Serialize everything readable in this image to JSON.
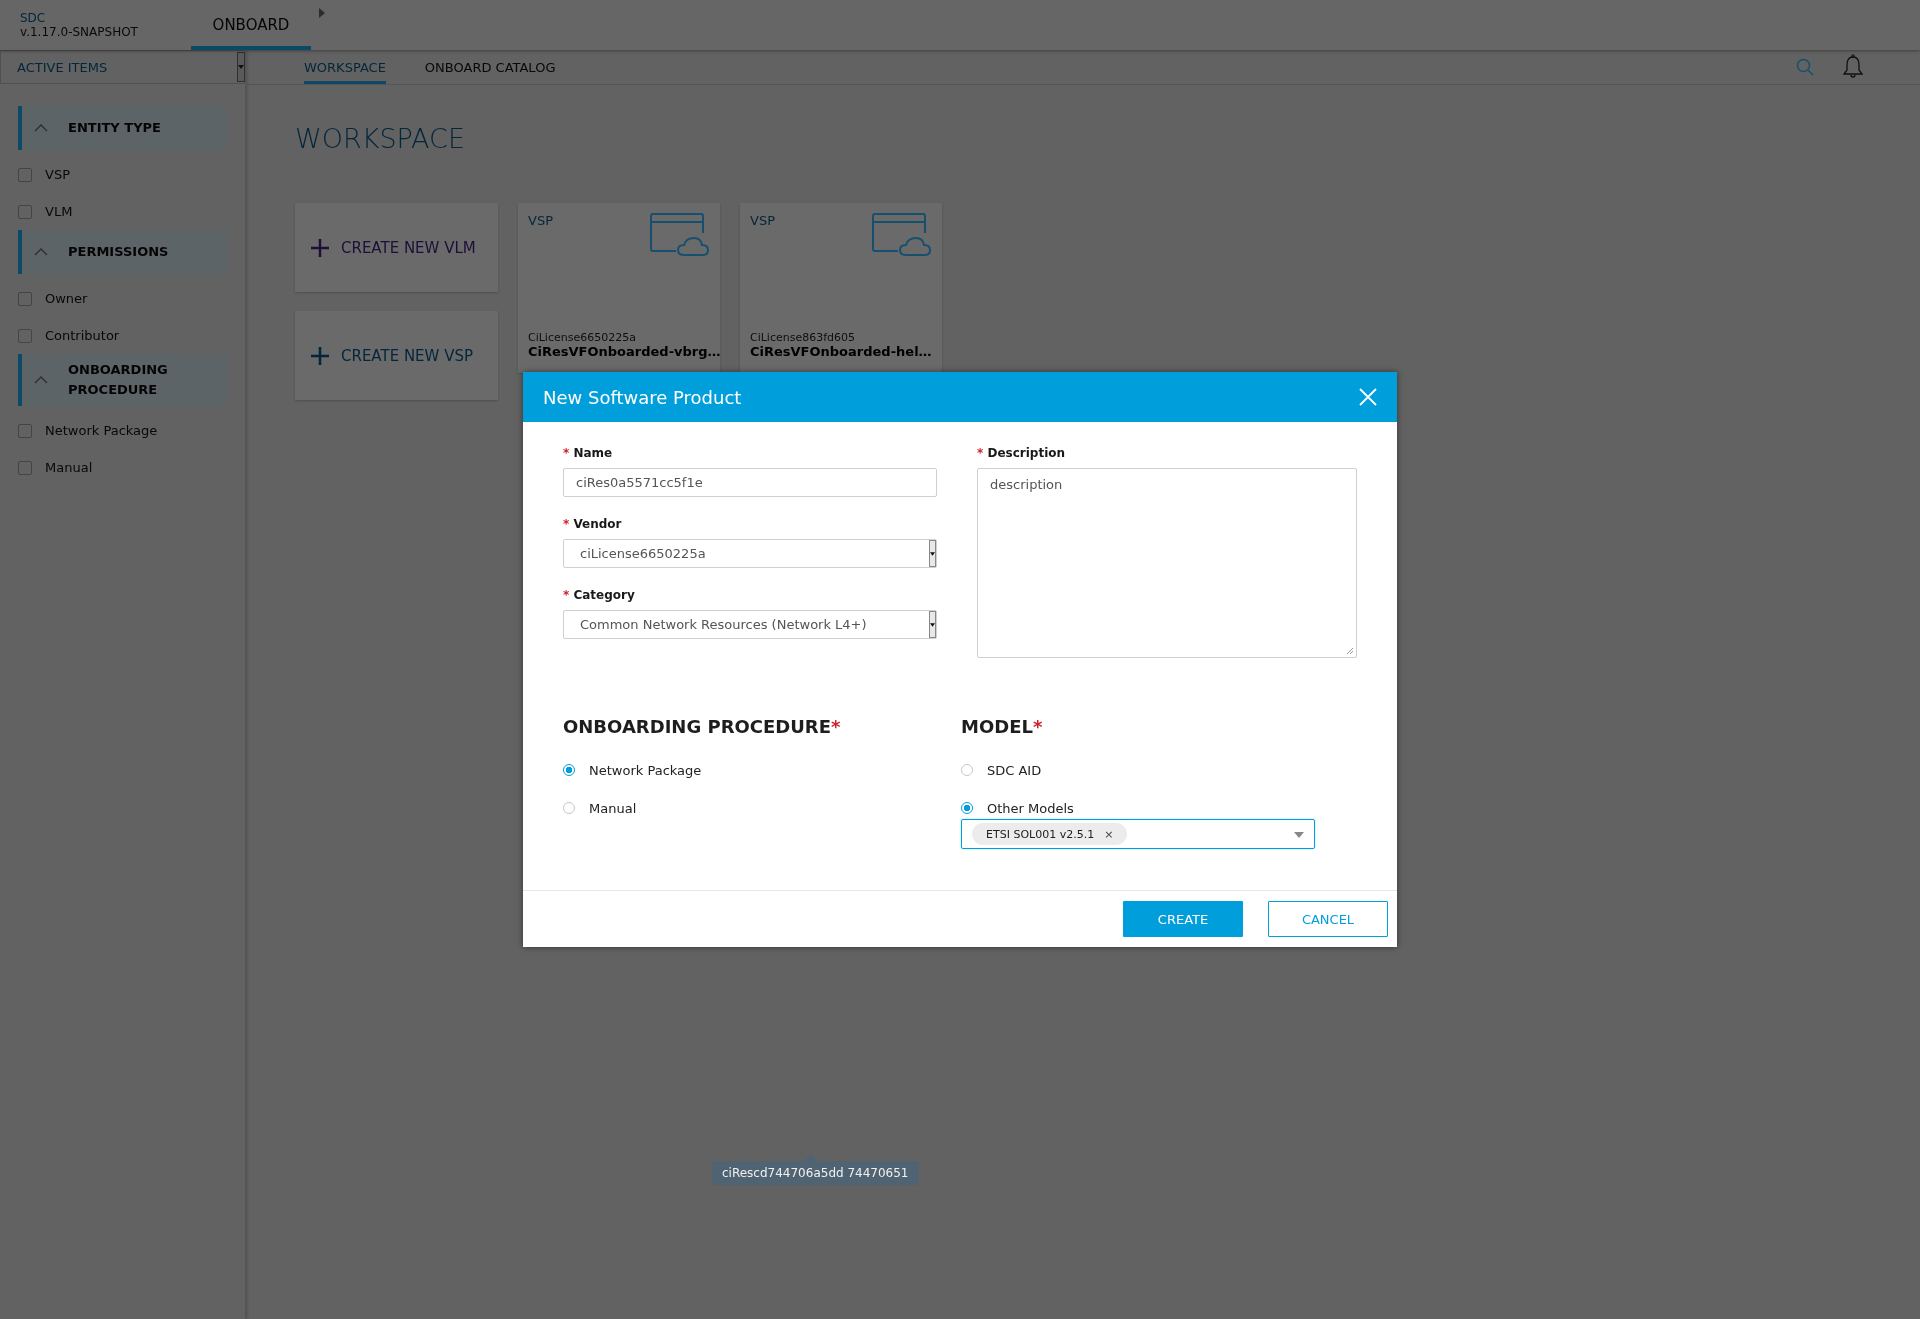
{
  "header": {
    "brand": "SDC",
    "version": "v.1.17.0-SNAPSHOT",
    "tabs": [
      {
        "label": "ONBOARD",
        "selected": true
      }
    ]
  },
  "active_items": {
    "label": "ACTIVE ITEMS"
  },
  "nav_tabs": [
    {
      "label": "WORKSPACE",
      "selected": true
    },
    {
      "label": "ONBOARD CATALOG",
      "selected": false
    }
  ],
  "sidebar": {
    "groups": [
      {
        "title": "ENTITY TYPE",
        "expanded": true,
        "items": [
          {
            "label": "VSP",
            "checked": false
          },
          {
            "label": "VLM",
            "checked": false
          }
        ]
      },
      {
        "title": "PERMISSIONS",
        "expanded": true,
        "items": [
          {
            "label": "Owner",
            "checked": false
          },
          {
            "label": "Contributor",
            "checked": false
          }
        ]
      },
      {
        "title": "ONBOARDING PROCEDURE",
        "expanded": true,
        "items": [
          {
            "label": "Network Package",
            "checked": false
          },
          {
            "label": "Manual",
            "checked": false
          }
        ]
      }
    ]
  },
  "page_title": "WORKSPACE",
  "create_cards": [
    {
      "label": "CREATE NEW VLM",
      "kind": "vlm"
    },
    {
      "label": "CREATE NEW VSP",
      "kind": "vsp"
    }
  ],
  "items": [
    {
      "type": "VSP",
      "vendor": "CiLicense6650225a",
      "name": "CiResVFOnboarded-vbrg…"
    },
    {
      "type": "VSP",
      "vendor": "CiLicense863fd605",
      "name": "CiResVFOnboarded-hel…"
    }
  ],
  "dialog": {
    "title": "New Software Product",
    "fields": [
      {
        "label": "Name",
        "required_mark": "*",
        "kind": "text",
        "value": "ciRes0a5571cc5f1e"
      },
      {
        "label": "Vendor",
        "required_mark": "*",
        "kind": "select",
        "value": "ciLicense6650225a"
      },
      {
        "label": "Category",
        "required_mark": "*",
        "kind": "select",
        "value": "Common Network Resources (Network L4+)"
      }
    ],
    "description": {
      "label": "Description",
      "required_mark": "*",
      "value": "description"
    },
    "sections": [
      {
        "title": "ONBOARDING PROCEDURE",
        "required_mark": "*",
        "options": [
          {
            "label": "Network Package",
            "selected": true
          },
          {
            "label": "Manual",
            "selected": false
          }
        ]
      },
      {
        "title": "MODEL",
        "required_mark": "*",
        "options": [
          {
            "label": "SDC AID",
            "selected": false
          },
          {
            "label": "Other Models",
            "selected": true
          }
        ],
        "multiselect": {
          "tags": [
            {
              "label": "ETSI SOL001 v2.5.1",
              "remove": "×"
            }
          ]
        }
      }
    ],
    "buttons": [
      {
        "label": "CREATE",
        "kind": "primary"
      },
      {
        "label": "CANCEL",
        "kind": "secondary"
      }
    ]
  },
  "tooltip": "ciRescd744706a5dd 74470651"
}
